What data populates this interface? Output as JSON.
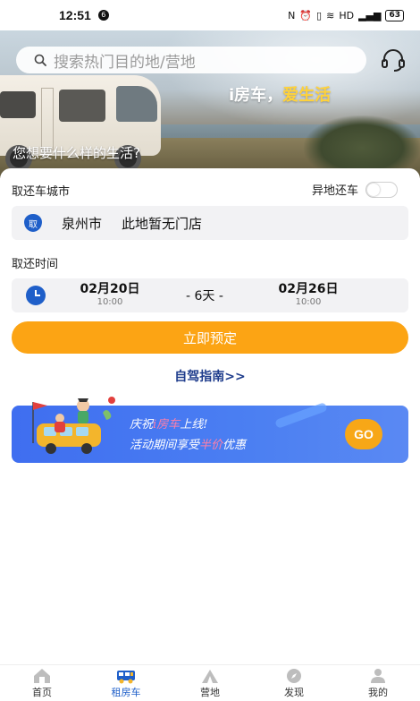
{
  "status_bar": {
    "time": "12:51",
    "notif": "6",
    "network": "HD",
    "battery": "63"
  },
  "hero": {
    "search_placeholder": "搜索热门目的地/营地",
    "slogan_part1": "i房车，",
    "slogan_part2": "爱生活",
    "tagline": "您想要什么样的生活?"
  },
  "form": {
    "city_section_label": "取还车城市",
    "diff_return_label": "异地还车",
    "diff_return_on": false,
    "pickup_badge": "取",
    "city": "泉州市",
    "store": "此地暂无门店",
    "time_section_label": "取还时间",
    "pickup_date": "02月20日",
    "pickup_time": "10:00",
    "duration": "- 6天 -",
    "return_date": "02月26日",
    "return_time": "10:00",
    "book_button": "立即预定",
    "guide_link": "自驾指南>>"
  },
  "banner": {
    "line1_prefix": "庆祝",
    "line1_brand": "i房车",
    "line1_suffix": "上线!",
    "line2_prefix": "活动期间享受",
    "line2_highlight": "半价",
    "line2_suffix": "优惠",
    "go_label": "GO"
  },
  "tabbar": {
    "items": [
      {
        "label": "首页",
        "icon": "home-icon"
      },
      {
        "label": "租房车",
        "icon": "rv-icon"
      },
      {
        "label": "营地",
        "icon": "tent-icon"
      },
      {
        "label": "发现",
        "icon": "compass-icon"
      },
      {
        "label": "我的",
        "icon": "user-icon"
      }
    ],
    "active_index": 1
  },
  "colors": {
    "accent": "#fca414",
    "brand_blue": "#1f5fc9",
    "banner_blue": "#4b7ff2"
  }
}
